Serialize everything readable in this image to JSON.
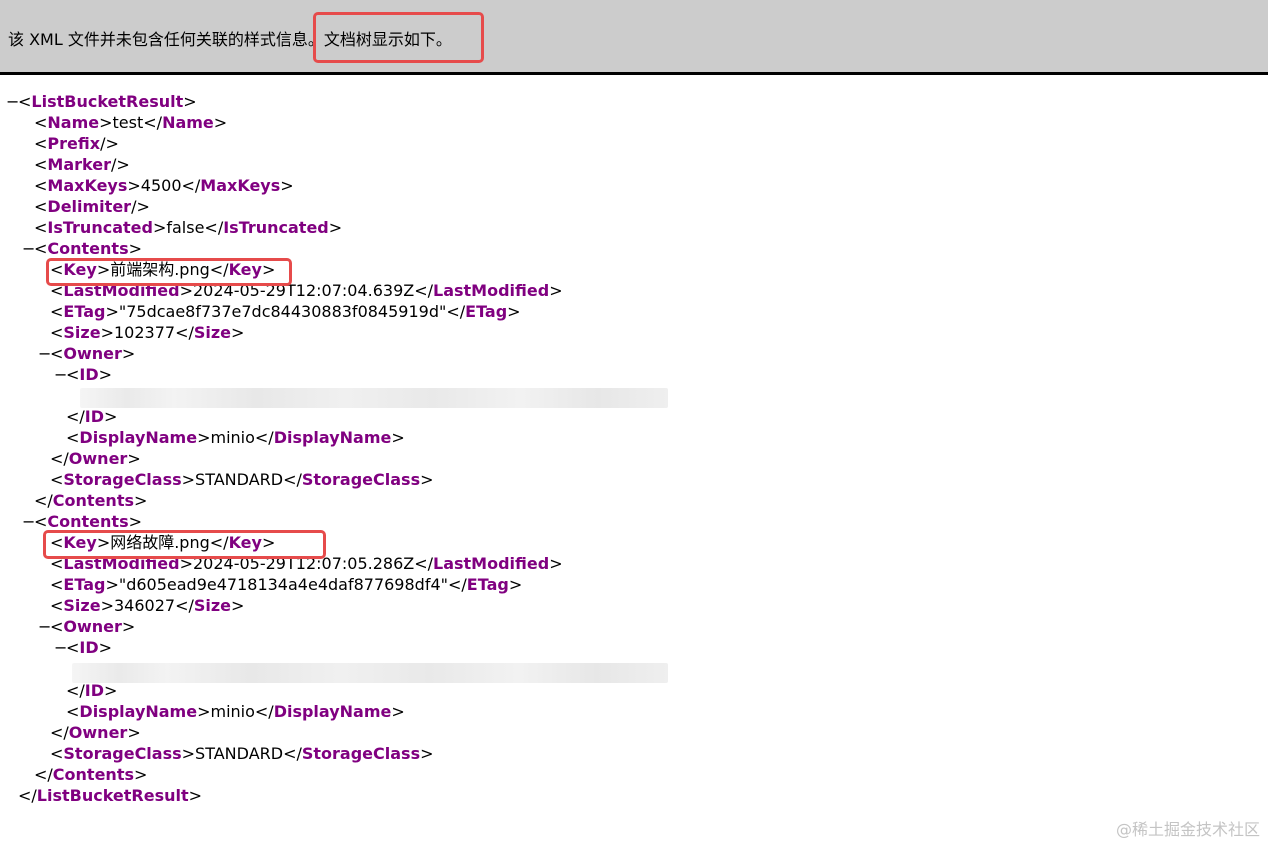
{
  "header": {
    "message": "该 XML 文件并未包含任何关联的样式信息。",
    "highlight_text": "文档树显示如下。",
    "colors": {
      "header_bg": "#cccccc",
      "highlight_border": "#e64b4b"
    }
  },
  "xml": {
    "tag_color": "#800080",
    "root_tag": "ListBucketResult",
    "name_tag": "Name",
    "name_value": "test",
    "prefix_tag": "Prefix",
    "marker_tag": "Marker",
    "maxkeys_tag": "MaxKeys",
    "maxkeys_value": "4500",
    "delimiter_tag": "Delimiter",
    "istruncated_tag": "IsTruncated",
    "istruncated_value": "false",
    "contents_tag": "Contents",
    "key_tag": "Key",
    "lastmodified_tag": "LastModified",
    "etag_tag": "ETag",
    "size_tag": "Size",
    "owner_tag": "Owner",
    "id_tag": "ID",
    "displayname_tag": "DisplayName",
    "storageclass_tag": "StorageClass",
    "contents": [
      {
        "key": "前端架构.png",
        "last_modified": "2024-05-29T12:07:04.639Z",
        "etag": "\"75dcae8f737e7dc84430883f0845919d\"",
        "size": "102377",
        "display_name": "minio",
        "storage_class": "STANDARD"
      },
      {
        "key": "网络故障.png",
        "last_modified": "2024-05-29T12:07:05.286Z",
        "etag": "\"d605ead9e4718134a4e4daf877698df4\"",
        "size": "346027",
        "display_name": "minio",
        "storage_class": "STANDARD"
      }
    ],
    "toggle_symbol": "−"
  },
  "watermark": "@稀土掘金技术社区"
}
